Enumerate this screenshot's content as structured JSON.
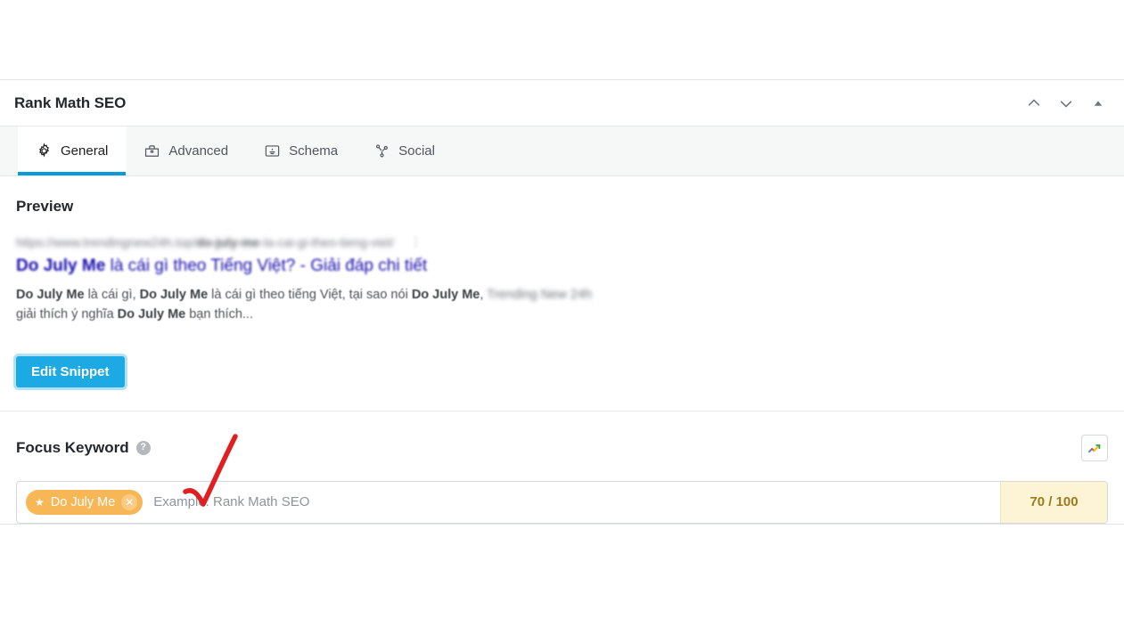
{
  "metabox": {
    "title": "Rank Math SEO",
    "actions": [
      {
        "name": "move-up-icon",
        "label": "Move up"
      },
      {
        "name": "move-down-icon",
        "label": "Move down"
      },
      {
        "name": "collapse-icon",
        "label": "Toggle panel"
      }
    ],
    "tabs": [
      {
        "label": "General",
        "icon": "gear-icon",
        "active": true
      },
      {
        "label": "Advanced",
        "icon": "toolbox-icon",
        "active": false
      },
      {
        "label": "Schema",
        "icon": "schema-icon",
        "active": false
      },
      {
        "label": "Social",
        "icon": "share-icon",
        "active": false
      }
    ]
  },
  "preview": {
    "heading": "Preview",
    "url_prefix": "https://www.trendingnew24h.top/",
    "url_highlight": "do-july-me",
    "url_suffix": "-la-cai-gi-theo-tieng-viet/",
    "url_menu": "⋮",
    "title_bold": "Do July Me",
    "title_rest": " là cái gì theo Tiếng Việt? - Giải đáp chi tiết",
    "description_parts": [
      {
        "text": "Do July Me",
        "bold": true
      },
      {
        "text": " là cái gì, ",
        "bold": false
      },
      {
        "text": "Do July Me",
        "bold": true
      },
      {
        "text": " là cái gì theo tiếng Việt, tại sao nói ",
        "bold": false
      },
      {
        "text": "Do July Me",
        "bold": true
      },
      {
        "text": ", ",
        "bold": false
      }
    ],
    "description_site": "Trending New 24h",
    "description_line2_pre": "giải thích ý nghĩa ",
    "description_line2_bold": "Do July Me",
    "description_line2_post": " bạn thích...",
    "edit_snippet_label": "Edit Snippet"
  },
  "focus_keyword": {
    "label": "Focus Keyword",
    "help_glyph": "?",
    "trends_icon": "google-trends-icon",
    "tag": {
      "star_glyph": "★",
      "text": "Do July Me",
      "remove_glyph": "✕"
    },
    "placeholder": "Example: Rank Math SEO",
    "value": "",
    "score": "70 / 100"
  },
  "colors": {
    "accent_blue": "#069ada",
    "button_blue": "#1da9e3",
    "tag_orange": "#f8b756",
    "score_bg": "#fdf3d5",
    "score_text": "#9b7b1e",
    "annotation_red": "#e02020"
  }
}
